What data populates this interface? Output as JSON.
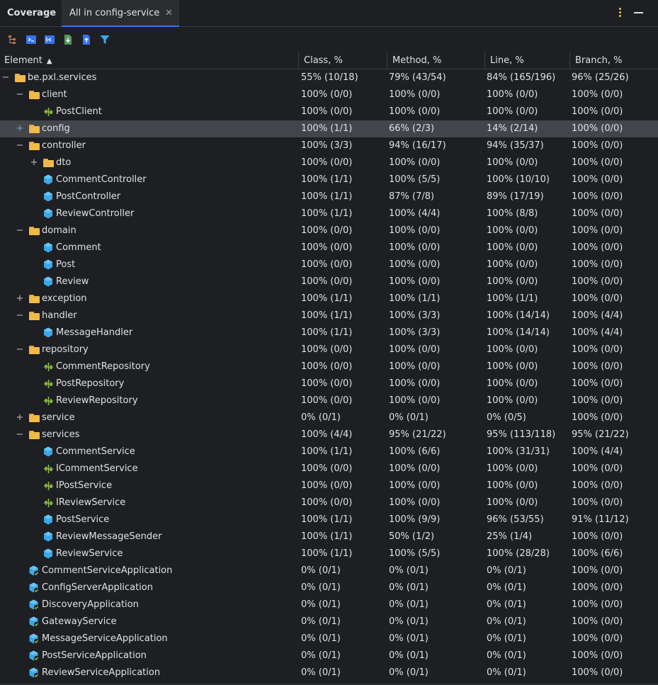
{
  "header": {
    "tool_title": "Coverage",
    "active_tab": "All in config-service"
  },
  "columns": [
    "Element",
    "Class, %",
    "Method, %",
    "Line, %",
    "Branch, %"
  ],
  "rows": [
    {
      "depth": 0,
      "exp": "minus",
      "icon": "folder",
      "name": "be.pxl.services",
      "cls": "55% (10/18)",
      "method": "79% (43/54)",
      "line": "84% (165/196)",
      "branch": "96% (25/26)"
    },
    {
      "depth": 1,
      "exp": "minus",
      "icon": "folder",
      "name": "client",
      "cls": "100% (0/0)",
      "method": "100% (0/0)",
      "line": "100% (0/0)",
      "branch": "100% (0/0)"
    },
    {
      "depth": 2,
      "exp": "none",
      "icon": "interface",
      "name": "PostClient",
      "cls": "100% (0/0)",
      "method": "100% (0/0)",
      "line": "100% (0/0)",
      "branch": "100% (0/0)"
    },
    {
      "depth": 1,
      "exp": "plus",
      "icon": "folder",
      "name": "config",
      "cls": "100% (1/1)",
      "method": "66% (2/3)",
      "line": "14% (2/14)",
      "branch": "100% (0/0)",
      "selected": true
    },
    {
      "depth": 1,
      "exp": "minus",
      "icon": "folder",
      "name": "controller",
      "cls": "100% (3/3)",
      "method": "94% (16/17)",
      "line": "94% (35/37)",
      "branch": "100% (0/0)"
    },
    {
      "depth": 2,
      "exp": "plus",
      "icon": "folder",
      "name": "dto",
      "cls": "100% (0/0)",
      "method": "100% (0/0)",
      "line": "100% (0/0)",
      "branch": "100% (0/0)"
    },
    {
      "depth": 2,
      "exp": "none",
      "icon": "class",
      "name": "CommentController",
      "cls": "100% (1/1)",
      "method": "100% (5/5)",
      "line": "100% (10/10)",
      "branch": "100% (0/0)"
    },
    {
      "depth": 2,
      "exp": "none",
      "icon": "class",
      "name": "PostController",
      "cls": "100% (1/1)",
      "method": "87% (7/8)",
      "line": "89% (17/19)",
      "branch": "100% (0/0)"
    },
    {
      "depth": 2,
      "exp": "none",
      "icon": "class",
      "name": "ReviewController",
      "cls": "100% (1/1)",
      "method": "100% (4/4)",
      "line": "100% (8/8)",
      "branch": "100% (0/0)"
    },
    {
      "depth": 1,
      "exp": "minus",
      "icon": "folder",
      "name": "domain",
      "cls": "100% (0/0)",
      "method": "100% (0/0)",
      "line": "100% (0/0)",
      "branch": "100% (0/0)"
    },
    {
      "depth": 2,
      "exp": "none",
      "icon": "class",
      "name": "Comment",
      "cls": "100% (0/0)",
      "method": "100% (0/0)",
      "line": "100% (0/0)",
      "branch": "100% (0/0)"
    },
    {
      "depth": 2,
      "exp": "none",
      "icon": "class",
      "name": "Post",
      "cls": "100% (0/0)",
      "method": "100% (0/0)",
      "line": "100% (0/0)",
      "branch": "100% (0/0)"
    },
    {
      "depth": 2,
      "exp": "none",
      "icon": "class",
      "name": "Review",
      "cls": "100% (0/0)",
      "method": "100% (0/0)",
      "line": "100% (0/0)",
      "branch": "100% (0/0)"
    },
    {
      "depth": 1,
      "exp": "plus",
      "icon": "folder",
      "name": "exception",
      "cls": "100% (1/1)",
      "method": "100% (1/1)",
      "line": "100% (1/1)",
      "branch": "100% (0/0)"
    },
    {
      "depth": 1,
      "exp": "minus",
      "icon": "folder",
      "name": "handler",
      "cls": "100% (1/1)",
      "method": "100% (3/3)",
      "line": "100% (14/14)",
      "branch": "100% (4/4)"
    },
    {
      "depth": 2,
      "exp": "none",
      "icon": "class",
      "name": "MessageHandler",
      "cls": "100% (1/1)",
      "method": "100% (3/3)",
      "line": "100% (14/14)",
      "branch": "100% (4/4)"
    },
    {
      "depth": 1,
      "exp": "minus",
      "icon": "folder",
      "name": "repository",
      "cls": "100% (0/0)",
      "method": "100% (0/0)",
      "line": "100% (0/0)",
      "branch": "100% (0/0)"
    },
    {
      "depth": 2,
      "exp": "none",
      "icon": "interface",
      "name": "CommentRepository",
      "cls": "100% (0/0)",
      "method": "100% (0/0)",
      "line": "100% (0/0)",
      "branch": "100% (0/0)"
    },
    {
      "depth": 2,
      "exp": "none",
      "icon": "interface",
      "name": "PostRepository",
      "cls": "100% (0/0)",
      "method": "100% (0/0)",
      "line": "100% (0/0)",
      "branch": "100% (0/0)"
    },
    {
      "depth": 2,
      "exp": "none",
      "icon": "interface",
      "name": "ReviewRepository",
      "cls": "100% (0/0)",
      "method": "100% (0/0)",
      "line": "100% (0/0)",
      "branch": "100% (0/0)"
    },
    {
      "depth": 1,
      "exp": "plus",
      "icon": "folder",
      "name": "service",
      "cls": "0% (0/1)",
      "method": "0% (0/1)",
      "line": "0% (0/5)",
      "branch": "100% (0/0)"
    },
    {
      "depth": 1,
      "exp": "minus",
      "icon": "folder",
      "name": "services",
      "cls": "100% (4/4)",
      "method": "95% (21/22)",
      "line": "95% (113/118)",
      "branch": "95% (21/22)"
    },
    {
      "depth": 2,
      "exp": "none",
      "icon": "class",
      "name": "CommentService",
      "cls": "100% (1/1)",
      "method": "100% (6/6)",
      "line": "100% (31/31)",
      "branch": "100% (4/4)"
    },
    {
      "depth": 2,
      "exp": "none",
      "icon": "interface",
      "name": "ICommentService",
      "cls": "100% (0/0)",
      "method": "100% (0/0)",
      "line": "100% (0/0)",
      "branch": "100% (0/0)"
    },
    {
      "depth": 2,
      "exp": "none",
      "icon": "interface",
      "name": "IPostService",
      "cls": "100% (0/0)",
      "method": "100% (0/0)",
      "line": "100% (0/0)",
      "branch": "100% (0/0)"
    },
    {
      "depth": 2,
      "exp": "none",
      "icon": "interface",
      "name": "IReviewService",
      "cls": "100% (0/0)",
      "method": "100% (0/0)",
      "line": "100% (0/0)",
      "branch": "100% (0/0)"
    },
    {
      "depth": 2,
      "exp": "none",
      "icon": "class",
      "name": "PostService",
      "cls": "100% (1/1)",
      "method": "100% (9/9)",
      "line": "96% (53/55)",
      "branch": "91% (11/12)"
    },
    {
      "depth": 2,
      "exp": "none",
      "icon": "class",
      "name": "ReviewMessageSender",
      "cls": "100% (1/1)",
      "method": "50% (1/2)",
      "line": "25% (1/4)",
      "branch": "100% (0/0)"
    },
    {
      "depth": 2,
      "exp": "none",
      "icon": "class",
      "name": "ReviewService",
      "cls": "100% (1/1)",
      "method": "100% (5/5)",
      "line": "100% (28/28)",
      "branch": "100% (6/6)"
    },
    {
      "depth": 1,
      "exp": "none",
      "icon": "app",
      "name": "CommentServiceApplication",
      "cls": "0% (0/1)",
      "method": "0% (0/1)",
      "line": "0% (0/1)",
      "branch": "100% (0/0)"
    },
    {
      "depth": 1,
      "exp": "none",
      "icon": "app",
      "name": "ConfigServerApplication",
      "cls": "0% (0/1)",
      "method": "0% (0/1)",
      "line": "0% (0/1)",
      "branch": "100% (0/0)"
    },
    {
      "depth": 1,
      "exp": "none",
      "icon": "app",
      "name": "DiscoveryApplication",
      "cls": "0% (0/1)",
      "method": "0% (0/1)",
      "line": "0% (0/1)",
      "branch": "100% (0/0)"
    },
    {
      "depth": 1,
      "exp": "none",
      "icon": "app",
      "name": "GatewayService",
      "cls": "0% (0/1)",
      "method": "0% (0/1)",
      "line": "0% (0/1)",
      "branch": "100% (0/0)"
    },
    {
      "depth": 1,
      "exp": "none",
      "icon": "app",
      "name": "MessageServiceApplication",
      "cls": "0% (0/1)",
      "method": "0% (0/1)",
      "line": "0% (0/1)",
      "branch": "100% (0/0)"
    },
    {
      "depth": 1,
      "exp": "none",
      "icon": "app",
      "name": "PostServiceApplication",
      "cls": "0% (0/1)",
      "method": "0% (0/1)",
      "line": "0% (0/1)",
      "branch": "100% (0/0)"
    },
    {
      "depth": 1,
      "exp": "none",
      "icon": "app",
      "name": "ReviewServiceApplication",
      "cls": "0% (0/1)",
      "method": "0% (0/1)",
      "line": "0% (0/1)",
      "branch": "100% (0/0)"
    }
  ],
  "colors": {
    "background": "#1e1f22",
    "selected_row": "#43454a",
    "accent": "#3574f0",
    "folder": "#f0b949",
    "class_icon": "#3aa8e8",
    "interface_icon": "#8fbf49"
  }
}
